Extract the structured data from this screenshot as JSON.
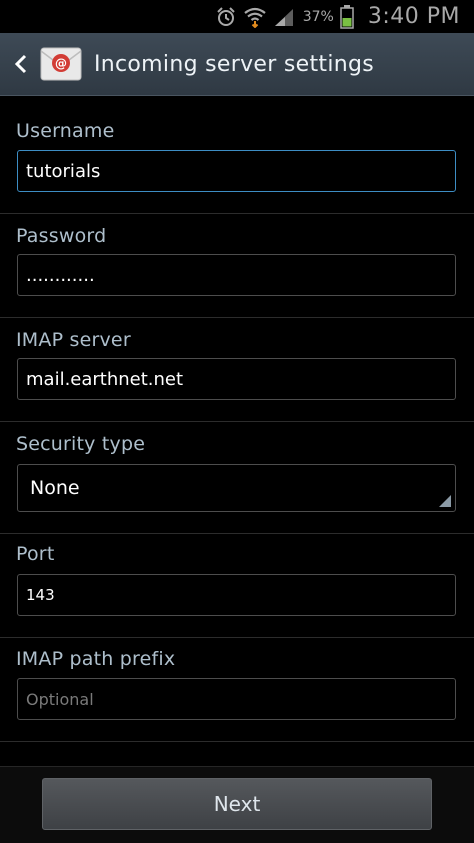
{
  "status_bar": {
    "battery_percent": "37%",
    "time": "3:40 PM",
    "icons": [
      "alarm-icon",
      "wifi-icon",
      "signal-icon",
      "battery-icon"
    ]
  },
  "header": {
    "title": "Incoming server settings",
    "app_icon": "email-app-icon"
  },
  "form": {
    "username": {
      "label": "Username",
      "value": "tutorials"
    },
    "password": {
      "label": "Password",
      "value": "............"
    },
    "imap_server": {
      "label": "IMAP server",
      "value": "mail.earthnet.net"
    },
    "security_type": {
      "label": "Security type",
      "value": "None"
    },
    "port": {
      "label": "Port",
      "value": "143"
    },
    "imap_path_prefix": {
      "label": "IMAP path prefix",
      "value": "",
      "placeholder": "Optional"
    }
  },
  "footer": {
    "next_label": "Next"
  },
  "colors": {
    "header_bg": "#34404b",
    "label": "#aebfcc",
    "focus_border": "#3d8dc4",
    "field_border": "#4d4d4d",
    "battery_green": "#7ac043"
  }
}
